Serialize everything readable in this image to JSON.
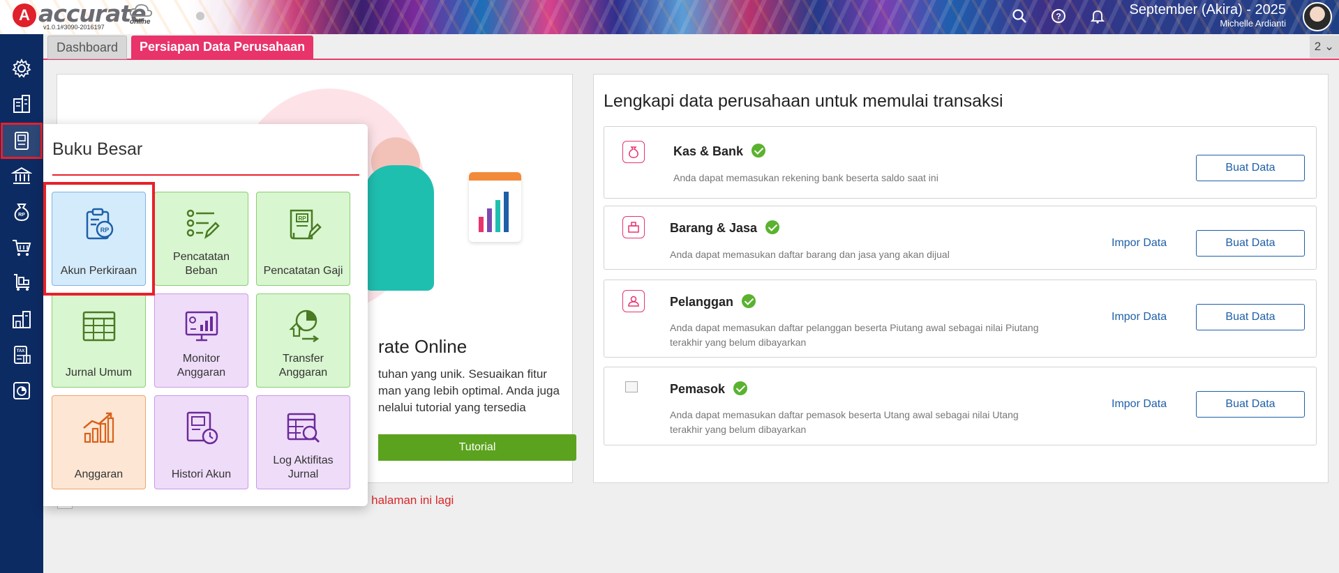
{
  "header": {
    "logo_text": "accurate",
    "logo_sub": "online",
    "version": "v1.0.1#3090-2016197",
    "company": "September (Akira) - 2025",
    "user": "Michelle Ardianti"
  },
  "tabs": [
    {
      "label": "Dashboard"
    },
    {
      "label": "Persiapan Data Perusahaan"
    }
  ],
  "tab_counter": "2",
  "left_card": {
    "title": "rate Online",
    "desc_line1": "tuhan yang unik. Sesuaikan fitur",
    "desc_line2": "man yang lebih optimal. Anda juga",
    "desc_line3": "nelalui tutorial yang tersedia",
    "tutorial_label": "Tutorial",
    "hide_text": "n halaman ini lagi"
  },
  "right_card": {
    "title": "Lengkapi data perusahaan untuk memulai transaksi",
    "impor_label": "Impor Data",
    "buat_label": "Buat Data",
    "rows": [
      {
        "title": "Kas & Bank",
        "desc1": "Anda dapat memasukan rekening bank beserta saldo saat ini",
        "desc2": ""
      },
      {
        "title": "Barang & Jasa",
        "desc1": "Anda dapat memasukan daftar barang dan jasa yang akan dijual",
        "desc2": ""
      },
      {
        "title": "Pelanggan",
        "desc1": "Anda dapat memasukan daftar pelanggan beserta Piutang awal sebagai nilai Piutang",
        "desc2": "terakhir yang belum dibayarkan"
      },
      {
        "title": "Pemasok",
        "desc1": "Anda dapat memasukan daftar pemasok beserta Utang awal sebagai nilai Utang",
        "desc2": "terakhir yang belum dibayarkan"
      }
    ]
  },
  "popup": {
    "title": "Buku Besar",
    "tiles": [
      {
        "label1": "Akun Perkiraan",
        "label2": "",
        "icon": "account-clipboard-icon"
      },
      {
        "label1": "Pencatatan",
        "label2": "Beban",
        "icon": "expense-list-icon"
      },
      {
        "label1": "Pencatatan Gaji",
        "label2": "",
        "icon": "salary-book-icon"
      },
      {
        "label1": "Jurnal Umum",
        "label2": "",
        "icon": "journal-grid-icon"
      },
      {
        "label1": "Monitor",
        "label2": "Anggaran",
        "icon": "monitor-chart-icon"
      },
      {
        "label1": "Transfer",
        "label2": "Anggaran",
        "icon": "budget-transfer-icon"
      },
      {
        "label1": "Anggaran",
        "label2": "",
        "icon": "budget-chart-icon"
      },
      {
        "label1": "Histori Akun",
        "label2": "",
        "icon": "account-history-icon"
      },
      {
        "label1": "Log Aktifitas",
        "label2": "Jurnal",
        "icon": "journal-log-icon"
      }
    ]
  },
  "colors": {
    "accent": "#e8336b",
    "sidebar": "#0d2b63",
    "primary_blue": "#1e5fa8",
    "success": "#5ab22f",
    "tutorial_green": "#5ba31e",
    "highlight_red": "#e8202a"
  }
}
